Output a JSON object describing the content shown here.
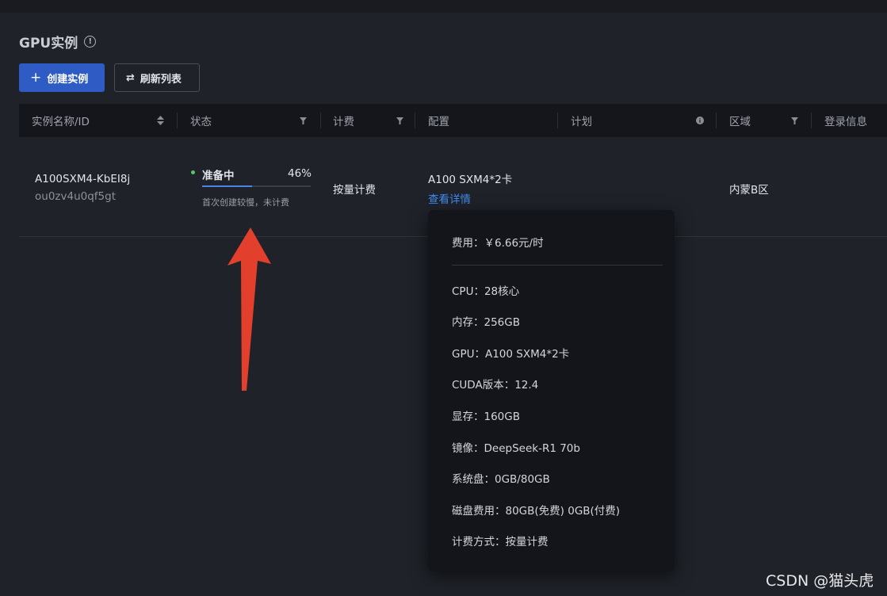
{
  "page": {
    "title": "GPU实例",
    "info_glyph": "!"
  },
  "toolbar": {
    "create_label": "创建实例",
    "refresh_label": "刷新列表"
  },
  "table": {
    "columns": [
      "实例名称/ID",
      "状态",
      "计费",
      "配置",
      "计划",
      "区域",
      "登录信息"
    ],
    "rows": [
      {
        "name": "A100SXM4-KbEI8j",
        "id": "ou0zv4u0qf5gt",
        "status": "准备中",
        "progress_label": "46%",
        "progress": 0.46,
        "status_note": "首次创建较慢，未计费",
        "billing": "按量计费",
        "config": "A100 SXM4*2卡",
        "config_link": "查看详情",
        "region": "内蒙B区"
      }
    ]
  },
  "popover": {
    "fee": "费用：￥6.66元/时",
    "lines": [
      "CPU：28核心",
      "内存：256GB",
      "GPU：A100 SXM4*2卡",
      "CUDA版本：12.4",
      "显存：160GB",
      "镜像：DeepSeek-R1 70b",
      "系统盘：0GB/80GB",
      "磁盘费用：80GB(免费) 0GB(付费)",
      "计费方式：按量计费"
    ]
  },
  "watermark": "CSDN @猫头虎",
  "colors": {
    "background": "#1f2229",
    "primary": "#2f5bc4",
    "link": "#3f8cf0",
    "status_ok": "#54c66a",
    "annotation_arrow": "#e2402c"
  },
  "icons": {
    "create": "plus-icon",
    "refresh": "refresh-icon",
    "sort": "sort-icon",
    "filter": "filter-icon",
    "info": "info-icon"
  }
}
